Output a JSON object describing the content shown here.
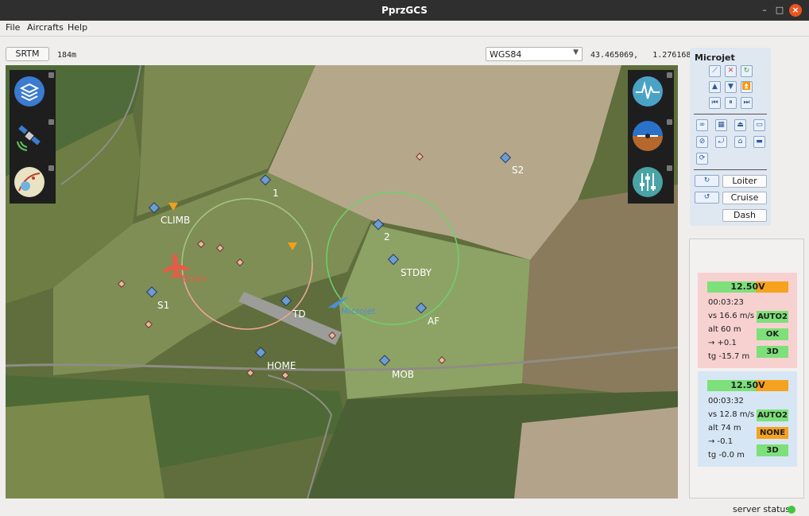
{
  "window": {
    "title": "PprzGCS"
  },
  "menu": [
    "File",
    "Aircrafts",
    "Help"
  ],
  "toolbar": {
    "srtm_label": "SRTM",
    "altitude": "184m",
    "projection": "WGS84",
    "coords": "43.465069,   1.276168"
  },
  "map": {
    "waypoints": [
      "1",
      "2",
      "S1",
      "S2",
      "CLIMB",
      "STDBY",
      "TD",
      "AF",
      "HOME",
      "MOB"
    ],
    "aircraft_labels": [
      "Bixler",
      "Microjet"
    ],
    "left_icons": [
      "layers-icon",
      "satellite-icon",
      "map-settings-icon"
    ],
    "right_icons": [
      "telemetry-icon",
      "attitude-icon",
      "settings-sliders-icon"
    ]
  },
  "aircraft_panel": {
    "name": "Microjet",
    "buttons": [
      "Loiter",
      "Cruise",
      "Dash"
    ],
    "colors": {
      "panel_bg": "#dfe7f1",
      "button_border": "#8aa7c7"
    }
  },
  "strips": [
    {
      "battery": "12.50V",
      "battery_level": 0.6,
      "time": "00:03:23",
      "vs": "vs  16.6 m/s",
      "alt": "alt  60 m",
      "climb": "→  +0.1",
      "tg": "tg  -15.7 m",
      "mode": "AUTO2",
      "mode_color": "#7de07a",
      "rc": "OK",
      "rc_color": "#7de07a",
      "gps": "3D",
      "gps_color": "#7de07a",
      "bg": "#f7d1d0"
    },
    {
      "battery": "12.50V",
      "battery_level": 0.6,
      "time": "00:03:32",
      "vs": "vs  12.8 m/s",
      "alt": "alt  74 m",
      "climb": "→  -0.1",
      "tg": "tg  -0.0 m",
      "mode": "AUTO2",
      "mode_color": "#7de07a",
      "rc": "NONE",
      "rc_color": "#f6a21e",
      "gps": "3D",
      "gps_color": "#7de07a",
      "bg": "#d7e6f4"
    }
  ],
  "server_status": "server status:"
}
